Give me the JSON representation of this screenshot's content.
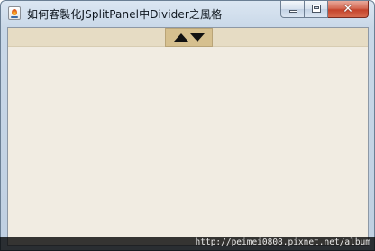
{
  "window": {
    "title": "如何客製化JSplitPanel中Divider之風格",
    "app_icon": "java-coffee-cup-icon",
    "caption_buttons": {
      "minimize": "minimize-icon",
      "maximize": "maximize-icon",
      "close": "close-icon",
      "close_glyph": "✕"
    }
  },
  "split_pane": {
    "divider": {
      "one_touch_buttons": [
        "arrow-up-icon",
        "arrow-down-icon"
      ]
    }
  },
  "watermark": {
    "text": "http://peimei0808.pixnet.net/album"
  },
  "colors": {
    "divider_bg": "#e6dcc4",
    "one_touch_bg": "#d6c08f",
    "pane_bg": "#f1ece2",
    "close_button": "#c4432b"
  }
}
